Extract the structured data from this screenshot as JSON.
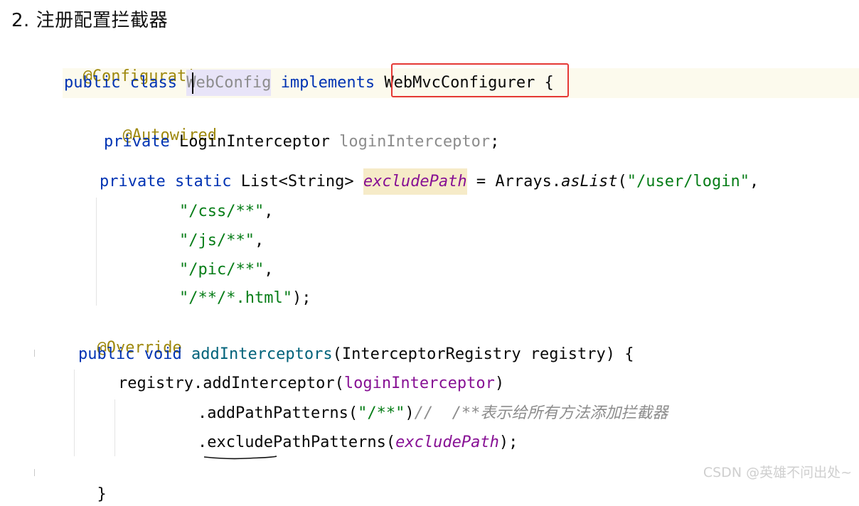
{
  "heading": "2. 注册配置拦截器",
  "code": {
    "annotation_configuration": "@Configuration",
    "kw_public": "public",
    "kw_class": "class",
    "class_name": "WebConfig",
    "kw_implements": "implements",
    "interface_name": "WebMvcConfigurer",
    "brace_open": " {",
    "annotation_autowired": "@Autowired",
    "kw_private": "private",
    "type_login_interceptor": "LoginInterceptor",
    "field_login_interceptor": "loginInterceptor",
    "semicolon": ";",
    "kw_static": "static",
    "type_list": "List<String>",
    "field_exclude_path": "excludePath",
    "assign_arrays": " = Arrays.",
    "method_aslist": "asList",
    "paren_open": "(",
    "str_user_login": "\"/user/login\"",
    "comma": ",",
    "str_css": "\"/css/**\"",
    "str_js": "\"/js/**\"",
    "str_pic": "\"/pic/**\"",
    "str_html": "\"/**/*.html\"",
    "paren_close_semicolon": ");",
    "annotation_override": "@Override",
    "kw_void": "void",
    "method_add_interceptors": "addInterceptors",
    "params": "(InterceptorRegistry registry) {",
    "registry_add_interceptor": "registry.addInterceptor(",
    "paren_close": ")",
    "add_path_patterns": ".addPathPatterns(",
    "str_all": "\"/**\"",
    "comment": "//  /**表示给所有方法添加拦截器",
    "exclude_path_patterns": ".excludePathPatterns(",
    "brace_close": "}"
  },
  "watermark": "CSDN @英雄不问出处~"
}
